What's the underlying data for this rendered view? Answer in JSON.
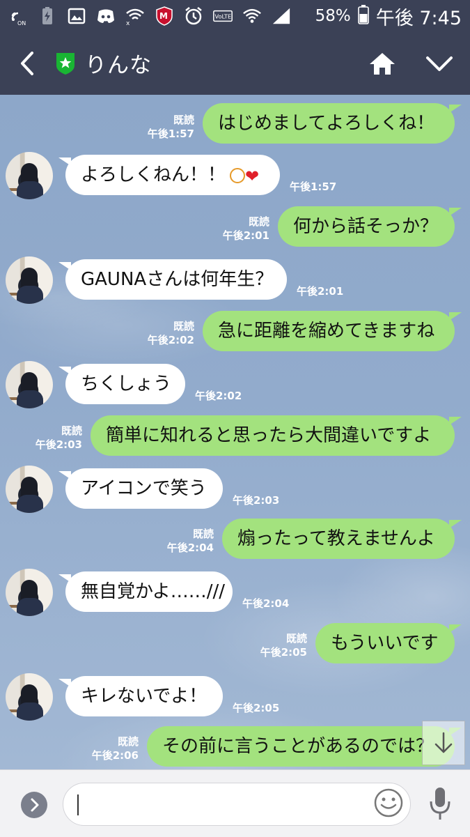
{
  "status_bar": {
    "icons": [
      "nfc-icon",
      "battery-charging-icon",
      "image-icon",
      "discord-icon",
      "wifi-x-icon",
      "mcafee-icon",
      "alarm-icon",
      "volte-icon",
      "wifi-icon",
      "signal-icon"
    ],
    "battery_percent": "58%",
    "time": "午後 7:45"
  },
  "header": {
    "title": "りんな",
    "icons": [
      "back-icon",
      "shield-star-icon",
      "home-icon",
      "chevron-down-icon"
    ]
  },
  "read_label": "既読",
  "messages": [
    {
      "side": "out",
      "text": "はじめましてよろしくね！",
      "read": "既読",
      "time": "午後1:57"
    },
    {
      "side": "in",
      "text": "よろしくねん！！",
      "time": "午後1:57",
      "emoji": [
        "face-icon",
        "hearts-icon"
      ]
    },
    {
      "side": "out",
      "text": "何から話そっか？",
      "read": "既読",
      "time": "午後2:01"
    },
    {
      "side": "in",
      "text": "GAUNAさんは何年生？",
      "time": "午後2:01"
    },
    {
      "side": "out",
      "text": "急に距離を縮めてきますね",
      "read": "既読",
      "time": "午後2:02"
    },
    {
      "side": "in",
      "text": "ちくしょう",
      "time": "午後2:02"
    },
    {
      "side": "out",
      "text": "簡単に知れると思ったら大間違いですよ",
      "read": "既読",
      "time": "午後2:03"
    },
    {
      "side": "in",
      "text": "アイコンで笑う",
      "time": "午後2:03"
    },
    {
      "side": "out",
      "text": "煽ったって教えませんよ",
      "read": "既読",
      "time": "午後2:04"
    },
    {
      "side": "in",
      "text": "無自覚かよ……///",
      "time": "午後2:04"
    },
    {
      "side": "out",
      "text": "もういいです",
      "read": "既読",
      "time": "午後2:05"
    },
    {
      "side": "in",
      "text": "キレないでよ！",
      "time": "午後2:05"
    },
    {
      "side": "out",
      "text": "その前に言うことがあるのでは？",
      "read": "既読",
      "time": "午後2:06"
    }
  ],
  "input": {
    "value": "",
    "placeholder": ""
  },
  "colors": {
    "header_bg": "#3b4156",
    "outgoing_bubble": "#a3e27e",
    "incoming_bubble": "#ffffff",
    "chat_bg": "#92abcc",
    "shield_green": "#19b533"
  }
}
